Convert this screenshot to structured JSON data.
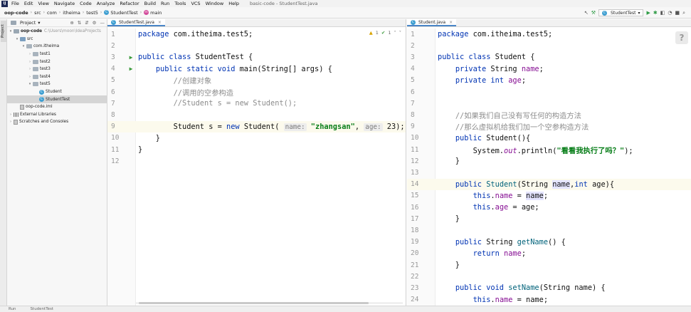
{
  "menubar": {
    "items": [
      "File",
      "Edit",
      "View",
      "Navigate",
      "Code",
      "Analyze",
      "Refactor",
      "Build",
      "Run",
      "Tools",
      "VCS",
      "Window",
      "Help"
    ],
    "window_title": "basic-code - StudentTest.java"
  },
  "breadcrumb": {
    "items": [
      "oop-code",
      "src",
      "com",
      "itheima",
      "test5",
      "StudentTest",
      "main"
    ]
  },
  "toolbar": {
    "run_config": "StudentTest"
  },
  "stripe": {
    "project_tab": "Project"
  },
  "project": {
    "title": "Project",
    "tree": [
      {
        "label": "oop-code",
        "hint": "C:\\Users\\moon\\IdeaProjects",
        "depth": 0,
        "arrow": "▾",
        "kind": "module"
      },
      {
        "label": "src",
        "hint": "",
        "depth": 1,
        "arrow": "▾",
        "kind": "src"
      },
      {
        "label": "com.itheima",
        "hint": "",
        "depth": 2,
        "arrow": "▾",
        "kind": "pkg"
      },
      {
        "label": "test1",
        "hint": "",
        "depth": 3,
        "arrow": "›",
        "kind": "pkg"
      },
      {
        "label": "test2",
        "hint": "",
        "depth": 3,
        "arrow": "›",
        "kind": "pkg"
      },
      {
        "label": "test3",
        "hint": "",
        "depth": 3,
        "arrow": "›",
        "kind": "pkg"
      },
      {
        "label": "test4",
        "hint": "",
        "depth": 3,
        "arrow": "›",
        "kind": "pkg"
      },
      {
        "label": "test5",
        "hint": "",
        "depth": 3,
        "arrow": "▾",
        "kind": "pkg"
      },
      {
        "label": "Student",
        "hint": "",
        "depth": 4,
        "arrow": "",
        "kind": "class"
      },
      {
        "label": "StudentTest",
        "hint": "",
        "depth": 4,
        "arrow": "",
        "kind": "class",
        "selected": true
      },
      {
        "label": "oop-code.iml",
        "hint": "",
        "depth": 1,
        "arrow": "",
        "kind": "file"
      },
      {
        "label": "External Libraries",
        "hint": "",
        "depth": 0,
        "arrow": "›",
        "kind": "lib"
      },
      {
        "label": "Scratches and Consoles",
        "hint": "",
        "depth": 0,
        "arrow": "›",
        "kind": "scratch"
      }
    ]
  },
  "editor_left": {
    "tab": "StudentTest.java",
    "inspections": {
      "warnings": "1",
      "ok": "1"
    },
    "current_line": 9,
    "lines": [
      {
        "n": "1",
        "run": false,
        "tokens": [
          [
            "kw",
            "package "
          ],
          [
            "",
            "com.itheima.test5;"
          ]
        ]
      },
      {
        "n": "2",
        "run": false,
        "tokens": []
      },
      {
        "n": "3",
        "run": true,
        "tokens": [
          [
            "kw",
            "public class "
          ],
          [
            "",
            "StudentTest {"
          ]
        ]
      },
      {
        "n": "4",
        "run": true,
        "tokens": [
          [
            "",
            "    "
          ],
          [
            "kw",
            "public static void "
          ],
          [
            "",
            "main(String[] args) {"
          ]
        ]
      },
      {
        "n": "5",
        "run": false,
        "tokens": [
          [
            "",
            "        "
          ],
          [
            "cm",
            "//创建对象"
          ]
        ]
      },
      {
        "n": "6",
        "run": false,
        "tokens": [
          [
            "",
            "        "
          ],
          [
            "cm",
            "//调用的空参构造"
          ]
        ]
      },
      {
        "n": "7",
        "run": false,
        "tokens": [
          [
            "",
            "        "
          ],
          [
            "cm",
            "//Student s = new Student();"
          ]
        ]
      },
      {
        "n": "8",
        "run": false,
        "tokens": []
      },
      {
        "n": "9",
        "run": false,
        "tokens": [
          [
            "",
            "        Student s = "
          ],
          [
            "kw",
            "new "
          ],
          [
            "",
            "Student( "
          ],
          [
            "hint",
            "name:"
          ],
          [
            "str",
            " \"zhangsan\""
          ],
          [
            "",
            ", "
          ],
          [
            "hint",
            "age:"
          ],
          [
            "",
            " 23);"
          ]
        ]
      },
      {
        "n": "10",
        "run": false,
        "tokens": [
          [
            "",
            "    }"
          ]
        ]
      },
      {
        "n": "11",
        "run": false,
        "tokens": [
          [
            "",
            "}"
          ]
        ]
      },
      {
        "n": "12",
        "run": false,
        "tokens": []
      }
    ]
  },
  "editor_right": {
    "tab": "Student.java",
    "current_line": 14,
    "lines": [
      {
        "n": "1",
        "tokens": [
          [
            "kw",
            "package "
          ],
          [
            "",
            "com.itheima.test5;"
          ]
        ]
      },
      {
        "n": "2",
        "tokens": []
      },
      {
        "n": "3",
        "tokens": [
          [
            "kw",
            "public class "
          ],
          [
            "",
            "Student {"
          ]
        ]
      },
      {
        "n": "4",
        "tokens": [
          [
            "",
            "    "
          ],
          [
            "kw",
            "private "
          ],
          [
            "",
            "String "
          ],
          [
            "fld",
            "name"
          ],
          [
            "",
            ";"
          ]
        ]
      },
      {
        "n": "5",
        "tokens": [
          [
            "",
            "    "
          ],
          [
            "kw",
            "private int "
          ],
          [
            "fld",
            "age"
          ],
          [
            "",
            ";"
          ]
        ]
      },
      {
        "n": "6",
        "tokens": []
      },
      {
        "n": "7",
        "tokens": []
      },
      {
        "n": "8",
        "tokens": [
          [
            "",
            "    "
          ],
          [
            "cm",
            "//如果我们自己没有写任何的构造方法"
          ]
        ]
      },
      {
        "n": "9",
        "tokens": [
          [
            "",
            "    "
          ],
          [
            "cm",
            "//那么虚拟机给我们加一个空参构造方法"
          ]
        ]
      },
      {
        "n": "10",
        "tokens": [
          [
            "",
            "    "
          ],
          [
            "kw",
            "public "
          ],
          [
            "",
            "Student(){"
          ]
        ]
      },
      {
        "n": "11",
        "tokens": [
          [
            "",
            "        System."
          ],
          [
            "fldit",
            "out"
          ],
          [
            "",
            ".println("
          ],
          [
            "str",
            "\"看看我执行了吗？\""
          ],
          [
            "",
            ");"
          ]
        ]
      },
      {
        "n": "12",
        "tokens": [
          [
            "",
            "    }"
          ]
        ]
      },
      {
        "n": "13",
        "tokens": []
      },
      {
        "n": "14",
        "tokens": [
          [
            "",
            "    "
          ],
          [
            "kw",
            "public "
          ],
          [
            "fn",
            "Student"
          ],
          [
            "",
            "(String "
          ],
          [
            "hl",
            "name"
          ],
          [
            "",
            ","
          ],
          [
            "kw",
            "int "
          ],
          [
            "",
            "age){"
          ]
        ]
      },
      {
        "n": "15",
        "tokens": [
          [
            "",
            "        "
          ],
          [
            "kw",
            "this"
          ],
          [
            "",
            "."
          ],
          [
            "fld",
            "name"
          ],
          [
            "",
            " = "
          ],
          [
            "hl",
            "name"
          ],
          [
            "",
            ";"
          ]
        ]
      },
      {
        "n": "16",
        "tokens": [
          [
            "",
            "        "
          ],
          [
            "kw",
            "this"
          ],
          [
            "",
            "."
          ],
          [
            "fld",
            "age"
          ],
          [
            "",
            " = age;"
          ]
        ]
      },
      {
        "n": "17",
        "tokens": [
          [
            "",
            "    }"
          ]
        ]
      },
      {
        "n": "18",
        "tokens": []
      },
      {
        "n": "19",
        "tokens": [
          [
            "",
            "    "
          ],
          [
            "kw",
            "public "
          ],
          [
            "",
            "String "
          ],
          [
            "fn",
            "getName"
          ],
          [
            "",
            "() {"
          ]
        ]
      },
      {
        "n": "20",
        "tokens": [
          [
            "",
            "        "
          ],
          [
            "kw",
            "return "
          ],
          [
            "fld",
            "name"
          ],
          [
            "",
            ";"
          ]
        ]
      },
      {
        "n": "21",
        "tokens": [
          [
            "",
            "    }"
          ]
        ]
      },
      {
        "n": "22",
        "tokens": []
      },
      {
        "n": "23",
        "tokens": [
          [
            "",
            "    "
          ],
          [
            "kw",
            "public void "
          ],
          [
            "fn",
            "setName"
          ],
          [
            "",
            "(String name) {"
          ]
        ]
      },
      {
        "n": "24",
        "tokens": [
          [
            "",
            "        "
          ],
          [
            "kw",
            "this"
          ],
          [
            "",
            "."
          ],
          [
            "fld",
            "name"
          ],
          [
            "",
            " = name;"
          ]
        ]
      }
    ]
  },
  "statusbar": {
    "items": [
      "Run",
      "StudentTest"
    ]
  },
  "help_icon": "?"
}
